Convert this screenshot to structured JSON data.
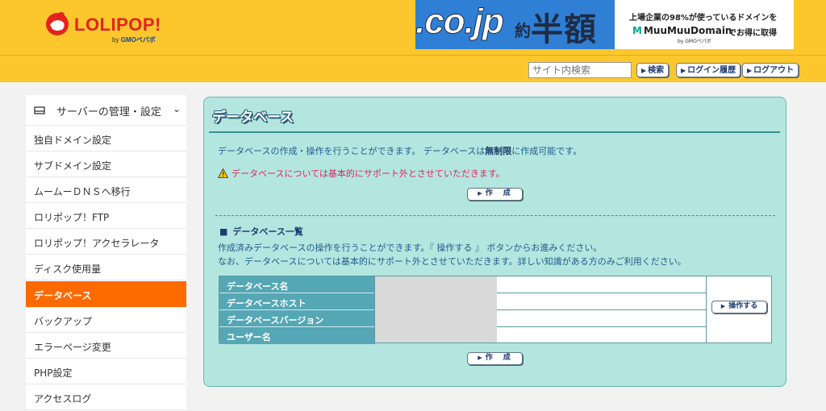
{
  "brand": {
    "logo_text": "LOLIPOP!",
    "logo_sub_by": "by",
    "logo_sub_company": "GMOペパボ",
    "colors": {
      "header": "#fcc72c",
      "logo_red": "#e4231f",
      "active_nav": "#ff6a00",
      "panel_bg": "#b4e6e0"
    }
  },
  "ad_banner": {
    "domain_text": ".co.jp",
    "discount_small": "約",
    "discount_big": "半額",
    "tagline": "上場企業の98%が使っているドメインを",
    "brand_name": "MuuMuuDomain",
    "brand_mark": "M",
    "note": "でお得に取得",
    "brand_by": "by GMOペパボ"
  },
  "toolbar": {
    "search_placeholder": "サイト内検索",
    "search_label": "検索",
    "login_history_label": "ログイン履歴",
    "logout_label": "ログアウト"
  },
  "sidebar": {
    "section_title": "サーバーの管理・設定",
    "section_icon": "server-icon",
    "items": [
      {
        "label": "独自ドメイン設定",
        "active": false
      },
      {
        "label": "サブドメイン設定",
        "active": false
      },
      {
        "label": "ムームーＤＮＳへ移行",
        "active": false
      },
      {
        "label": "ロリポップ！FTP",
        "active": false
      },
      {
        "label": "ロリポップ！アクセラレータ",
        "active": false
      },
      {
        "label": "ディスク使用量",
        "active": false
      },
      {
        "label": "データベース",
        "active": true
      },
      {
        "label": "バックアップ",
        "active": false
      },
      {
        "label": "エラーページ変更",
        "active": false
      },
      {
        "label": "PHP設定",
        "active": false
      },
      {
        "label": "アクセスログ",
        "active": false
      }
    ]
  },
  "main": {
    "title": "データベース",
    "description_pre": "データベースの作成・操作を行うことができます。 データベースは",
    "description_bold": "無制限",
    "description_post": "に作成可能です。",
    "warning": "データベースについては基本的にサポート外とさせていただきます。",
    "create_label": "作　成",
    "list_heading": "データベース一覧",
    "list_desc_1": "作成済みデータベースの操作を行うことができます。『 操作する 』 ボタンからお進みください。",
    "list_desc_2": "なお、データベースについては基本的にサポート外とさせていただきます。詳しい知識がある方のみご利用ください。",
    "table_labels": [
      "データベース名",
      "データベースホスト",
      "データベースバージョン",
      "ユーザー名"
    ],
    "operate_label": "操作する"
  }
}
